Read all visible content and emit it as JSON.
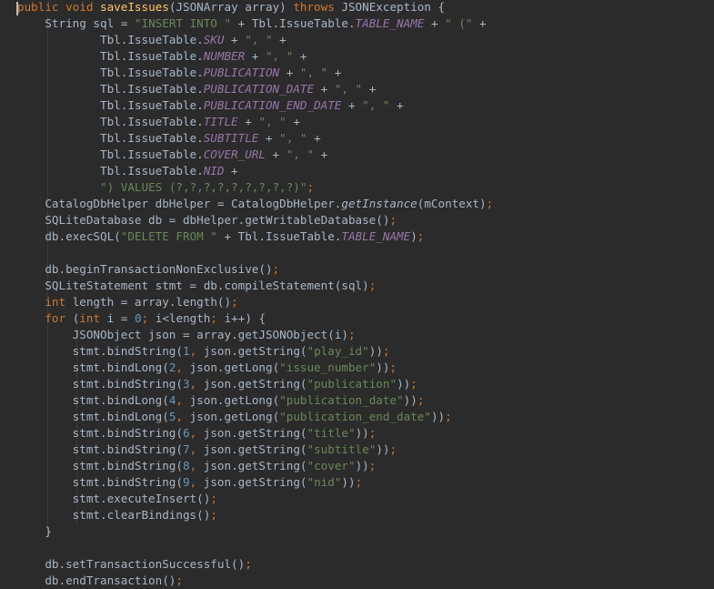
{
  "editor": {
    "lines": [
      [
        [
          "kw",
          "public "
        ],
        [
          "kw",
          "void "
        ],
        [
          "fn",
          "saveIssues"
        ],
        [
          "pl",
          "(JSONArray array) "
        ],
        [
          "kw",
          "throws "
        ],
        [
          "pl",
          "JSONException {"
        ]
      ],
      [
        [
          "pl",
          "    String sql = "
        ],
        [
          "str",
          "\"INSERT INTO \""
        ],
        [
          "pl",
          " + Tbl.IssueTable."
        ],
        [
          "field",
          "TABLE_NAME"
        ],
        [
          "pl",
          " + "
        ],
        [
          "str",
          "\" (\""
        ],
        [
          "pl",
          " +"
        ]
      ],
      [
        [
          "pl",
          "            Tbl.IssueTable."
        ],
        [
          "field",
          "SKU"
        ],
        [
          "pl",
          " + "
        ],
        [
          "str",
          "\", \""
        ],
        [
          "pl",
          " +"
        ]
      ],
      [
        [
          "pl",
          "            Tbl.IssueTable."
        ],
        [
          "field",
          "NUMBER"
        ],
        [
          "pl",
          " + "
        ],
        [
          "str",
          "\", \""
        ],
        [
          "pl",
          " +"
        ]
      ],
      [
        [
          "pl",
          "            Tbl.IssueTable."
        ],
        [
          "field",
          "PUBLICATION"
        ],
        [
          "pl",
          " + "
        ],
        [
          "str",
          "\", \""
        ],
        [
          "pl",
          " +"
        ]
      ],
      [
        [
          "pl",
          "            Tbl.IssueTable."
        ],
        [
          "field",
          "PUBLICATION_DATE"
        ],
        [
          "pl",
          " + "
        ],
        [
          "str",
          "\", \""
        ],
        [
          "pl",
          " +"
        ]
      ],
      [
        [
          "pl",
          "            Tbl.IssueTable."
        ],
        [
          "field",
          "PUBLICATION_END_DATE"
        ],
        [
          "pl",
          " + "
        ],
        [
          "str",
          "\", \""
        ],
        [
          "pl",
          " +"
        ]
      ],
      [
        [
          "pl",
          "            Tbl.IssueTable."
        ],
        [
          "field",
          "TITLE"
        ],
        [
          "pl",
          " + "
        ],
        [
          "str",
          "\", \""
        ],
        [
          "pl",
          " +"
        ]
      ],
      [
        [
          "pl",
          "            Tbl.IssueTable."
        ],
        [
          "field",
          "SUBTITLE"
        ],
        [
          "pl",
          " + "
        ],
        [
          "str",
          "\", \""
        ],
        [
          "pl",
          " +"
        ]
      ],
      [
        [
          "pl",
          "            Tbl.IssueTable."
        ],
        [
          "field",
          "COVER_URL"
        ],
        [
          "pl",
          " + "
        ],
        [
          "str",
          "\", \""
        ],
        [
          "pl",
          " +"
        ]
      ],
      [
        [
          "pl",
          "            Tbl.IssueTable."
        ],
        [
          "field",
          "NID"
        ],
        [
          "pl",
          " +"
        ]
      ],
      [
        [
          "pl",
          "            "
        ],
        [
          "str",
          "\") VALUES (?,?,?,?,?,?,?,?,?)\""
        ],
        [
          "kw",
          ";"
        ]
      ],
      [
        [
          "pl",
          "    CatalogDbHelper dbHelper = CatalogDbHelper."
        ],
        [
          "static",
          "getInstance"
        ],
        [
          "pl",
          "(mContext)"
        ],
        [
          "kw",
          ";"
        ]
      ],
      [
        [
          "pl",
          "    SQLiteDatabase db = dbHelper.getWritableDatabase()"
        ],
        [
          "kw",
          ";"
        ]
      ],
      [
        [
          "pl",
          "    db.execSQL("
        ],
        [
          "str",
          "\"DELETE FROM \""
        ],
        [
          "pl",
          " + Tbl.IssueTable."
        ],
        [
          "field",
          "TABLE_NAME"
        ],
        [
          "pl",
          ")"
        ],
        [
          "kw",
          ";"
        ]
      ],
      [],
      [
        [
          "pl",
          "    db.beginTransactionNonExclusive()"
        ],
        [
          "kw",
          ";"
        ]
      ],
      [
        [
          "pl",
          "    SQLiteStatement stmt = db.compileStatement(sql)"
        ],
        [
          "kw",
          ";"
        ]
      ],
      [
        [
          "pl",
          "    "
        ],
        [
          "kw",
          "int "
        ],
        [
          "pl",
          "length = array.length()"
        ],
        [
          "kw",
          ";"
        ]
      ],
      [
        [
          "pl",
          "    "
        ],
        [
          "kw",
          "for "
        ],
        [
          "pl",
          "("
        ],
        [
          "kw",
          "int "
        ],
        [
          "pl",
          "i = "
        ],
        [
          "num",
          "0"
        ],
        [
          "kw",
          "; "
        ],
        [
          "pl",
          "i<length"
        ],
        [
          "kw",
          "; "
        ],
        [
          "pl",
          "i++) {"
        ]
      ],
      [
        [
          "pl",
          "        JSONObject json = array.getJSONObject(i)"
        ],
        [
          "kw",
          ";"
        ]
      ],
      [
        [
          "pl",
          "        stmt.bindString("
        ],
        [
          "num",
          "1"
        ],
        [
          "kw",
          ", "
        ],
        [
          "pl",
          "json.getString("
        ],
        [
          "str",
          "\"play_id\""
        ],
        [
          "pl",
          "))"
        ],
        [
          "kw",
          ";"
        ]
      ],
      [
        [
          "pl",
          "        stmt.bindLong("
        ],
        [
          "num",
          "2"
        ],
        [
          "kw",
          ", "
        ],
        [
          "pl",
          "json.getLong("
        ],
        [
          "str",
          "\"issue_number\""
        ],
        [
          "pl",
          "))"
        ],
        [
          "kw",
          ";"
        ]
      ],
      [
        [
          "pl",
          "        stmt.bindString("
        ],
        [
          "num",
          "3"
        ],
        [
          "kw",
          ", "
        ],
        [
          "pl",
          "json.getString("
        ],
        [
          "str",
          "\"publication\""
        ],
        [
          "pl",
          "))"
        ],
        [
          "kw",
          ";"
        ]
      ],
      [
        [
          "pl",
          "        stmt.bindLong("
        ],
        [
          "num",
          "4"
        ],
        [
          "kw",
          ", "
        ],
        [
          "pl",
          "json.getLong("
        ],
        [
          "str",
          "\"publication_date\""
        ],
        [
          "pl",
          "))"
        ],
        [
          "kw",
          ";"
        ]
      ],
      [
        [
          "pl",
          "        stmt.bindLong("
        ],
        [
          "num",
          "5"
        ],
        [
          "kw",
          ", "
        ],
        [
          "pl",
          "json.getLong("
        ],
        [
          "str",
          "\"publication_end_date\""
        ],
        [
          "pl",
          "))"
        ],
        [
          "kw",
          ";"
        ]
      ],
      [
        [
          "pl",
          "        stmt.bindString("
        ],
        [
          "num",
          "6"
        ],
        [
          "kw",
          ", "
        ],
        [
          "pl",
          "json.getString("
        ],
        [
          "str",
          "\"title\""
        ],
        [
          "pl",
          "))"
        ],
        [
          "kw",
          ";"
        ]
      ],
      [
        [
          "pl",
          "        stmt.bindString("
        ],
        [
          "num",
          "7"
        ],
        [
          "kw",
          ", "
        ],
        [
          "pl",
          "json.getString("
        ],
        [
          "str",
          "\"subtitle\""
        ],
        [
          "pl",
          "))"
        ],
        [
          "kw",
          ";"
        ]
      ],
      [
        [
          "pl",
          "        stmt.bindString("
        ],
        [
          "num",
          "8"
        ],
        [
          "kw",
          ", "
        ],
        [
          "pl",
          "json.getString("
        ],
        [
          "str",
          "\"cover\""
        ],
        [
          "pl",
          "))"
        ],
        [
          "kw",
          ";"
        ]
      ],
      [
        [
          "pl",
          "        stmt.bindString("
        ],
        [
          "num",
          "9"
        ],
        [
          "kw",
          ", "
        ],
        [
          "pl",
          "json.getString("
        ],
        [
          "str",
          "\"nid\""
        ],
        [
          "pl",
          "))"
        ],
        [
          "kw",
          ";"
        ]
      ],
      [
        [
          "pl",
          "        stmt.executeInsert()"
        ],
        [
          "kw",
          ";"
        ]
      ],
      [
        [
          "pl",
          "        stmt.clearBindings()"
        ],
        [
          "kw",
          ";"
        ]
      ],
      [
        [
          "pl",
          "    }"
        ]
      ],
      [],
      [
        [
          "pl",
          "    db.setTransactionSuccessful()"
        ],
        [
          "kw",
          ";"
        ]
      ],
      [
        [
          "pl",
          "    db.endTransaction()"
        ],
        [
          "kw",
          ";"
        ]
      ]
    ]
  },
  "colors": {
    "background": "#2b2b2b",
    "plain": "#a9b7c6",
    "keyword": "#cc7832",
    "method_declaration": "#ffc66d",
    "string": "#6a8759",
    "number": "#6897bb",
    "static_field": "#9876aa"
  }
}
